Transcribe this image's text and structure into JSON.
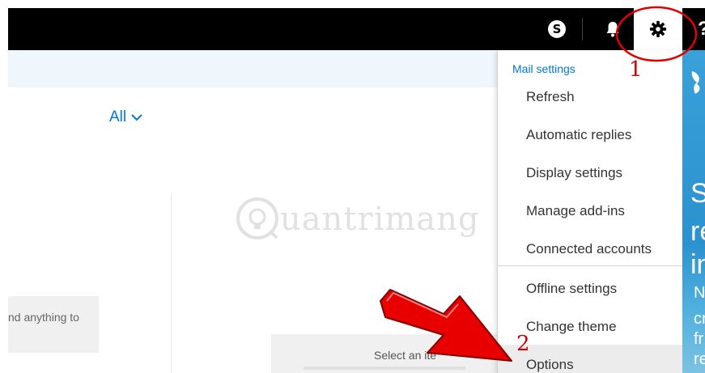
{
  "topbar": {
    "skype_glyph": "S",
    "help_glyph": "?",
    "icons": [
      "skype-icon",
      "bell-icon",
      "gear-icon",
      "help-icon"
    ]
  },
  "filter": {
    "label": "All"
  },
  "left_pane": {
    "empty_text": "nd anything to"
  },
  "reading_pane": {
    "select_text": "Select an ite"
  },
  "watermark": {
    "text": "uantrimang"
  },
  "menu": {
    "header": "Mail settings",
    "items": [
      "Refresh",
      "Automatic replies",
      "Display settings",
      "Manage add-ins",
      "Connected accounts",
      "Offline settings",
      "Change theme",
      "Options"
    ]
  },
  "promo": {
    "letters": [
      "S",
      "re",
      "in",
      "N",
      "cr",
      "fr",
      "re",
      "e"
    ]
  },
  "annotations": {
    "step1": "1",
    "step2": "2"
  },
  "colors": {
    "accent": "#0078d7",
    "annotation": "#d00000",
    "topbar": "#000000",
    "promo": "#2b92cf"
  }
}
